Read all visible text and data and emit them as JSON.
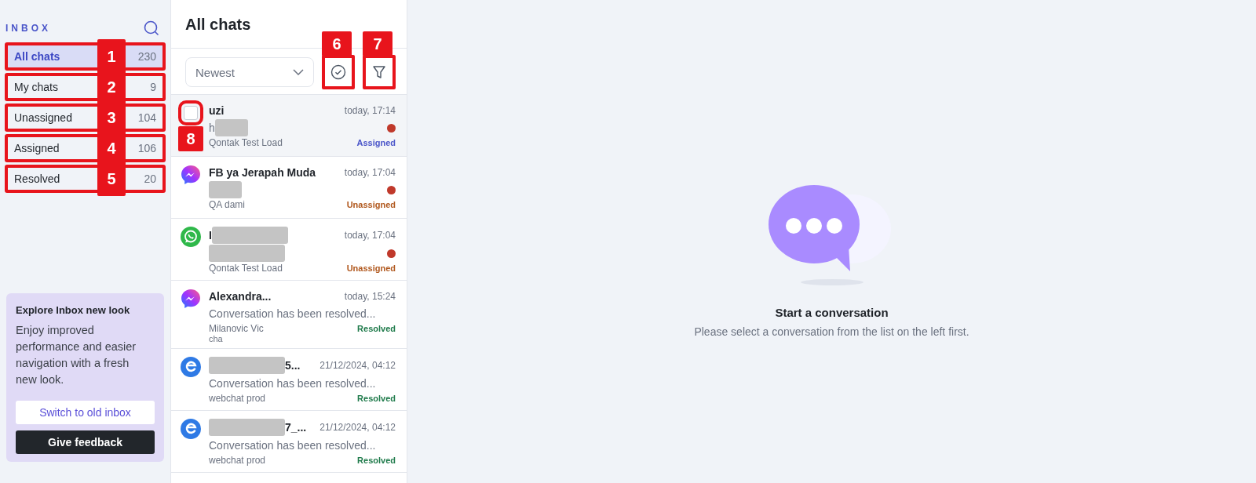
{
  "sidebar": {
    "title": "INBOX",
    "items": [
      {
        "label": "All chats",
        "count": "230",
        "selected": true,
        "callout": "1"
      },
      {
        "label": "My chats",
        "count": "9",
        "selected": false,
        "callout": "2"
      },
      {
        "label": "Unassigned",
        "count": "104",
        "selected": false,
        "callout": "3"
      },
      {
        "label": "Assigned",
        "count": "106",
        "selected": false,
        "callout": "4"
      },
      {
        "label": "Resolved",
        "count": "20",
        "selected": false,
        "callout": "5"
      }
    ],
    "promo": {
      "title": "Explore Inbox new look",
      "text": "Enjoy improved performance and easier navigation with a fresh new look.",
      "buttons": [
        {
          "kind": "secondary",
          "label": "Switch to old inbox"
        },
        {
          "kind": "primary",
          "label": "Give feedback"
        }
      ]
    }
  },
  "list": {
    "title": "All chats",
    "sort": {
      "value": "Newest"
    },
    "tools": [
      {
        "kind": "check",
        "callout": "6"
      },
      {
        "kind": "filter",
        "callout": "7"
      }
    ],
    "chats": [
      {
        "kind": "checkbox",
        "checked": false,
        "callout": "8",
        "selected": true,
        "name": [
          {
            "kind": "text",
            "text": "uzi"
          }
        ],
        "time": "today, 17:14",
        "preview": [
          {
            "kind": "text",
            "text": "h"
          },
          {
            "kind": "blur_short"
          }
        ],
        "unread": true,
        "channel": "Qontak Test Load",
        "status": {
          "text": "Assigned",
          "color": "#4a55c9"
        }
      },
      {
        "kind": "messenger",
        "selected": false,
        "name": [
          {
            "kind": "text",
            "text": "FB ya Jerapah Muda"
          }
        ],
        "time": "today, 17:04",
        "preview": [
          {
            "kind": "blur_short"
          }
        ],
        "unread": true,
        "channel": "QA dami",
        "status": {
          "text": "Unassigned",
          "color": "#b0571c"
        }
      },
      {
        "kind": "whatsapp",
        "selected": false,
        "name": [
          {
            "kind": "text",
            "text": "I"
          },
          {
            "kind": "blur"
          }
        ],
        "time": "today, 17:04",
        "preview": [
          {
            "kind": "blur"
          }
        ],
        "unread": true,
        "channel": "Qontak Test Load",
        "status": {
          "text": "Unassigned",
          "color": "#b0571c"
        }
      },
      {
        "kind": "messenger",
        "selected": false,
        "name": [
          {
            "kind": "text",
            "text": "Alexandra..."
          }
        ],
        "time": "today, 15:24",
        "preview": [
          {
            "kind": "text",
            "text": "Conversation has been resolved..."
          }
        ],
        "unread": false,
        "channel": "Milanovic Vic",
        "note": "cha",
        "status": {
          "text": "Resolved",
          "color": "#1e7a4a"
        }
      },
      {
        "kind": "webchat",
        "selected": false,
        "name": [
          {
            "kind": "blur"
          },
          {
            "kind": "text",
            "text": "5..."
          }
        ],
        "time": "21/12/2024, 04:12",
        "preview": [
          {
            "kind": "text",
            "text": "Conversation has been resolved..."
          }
        ],
        "unread": false,
        "channel": "webchat prod",
        "status": {
          "text": "Resolved",
          "color": "#1e7a4a"
        }
      },
      {
        "kind": "webchat",
        "selected": false,
        "name": [
          {
            "kind": "blur"
          },
          {
            "kind": "text",
            "text": "7_..."
          }
        ],
        "time": "21/12/2024, 04:12",
        "preview": [
          {
            "kind": "text",
            "text": "Conversation has been resolved..."
          }
        ],
        "unread": false,
        "channel": "webchat prod",
        "status": {
          "text": "Resolved",
          "color": "#1e7a4a"
        }
      }
    ]
  },
  "empty_state": {
    "title": "Start a conversation",
    "text": "Please select a conversation from the list on the left first."
  }
}
